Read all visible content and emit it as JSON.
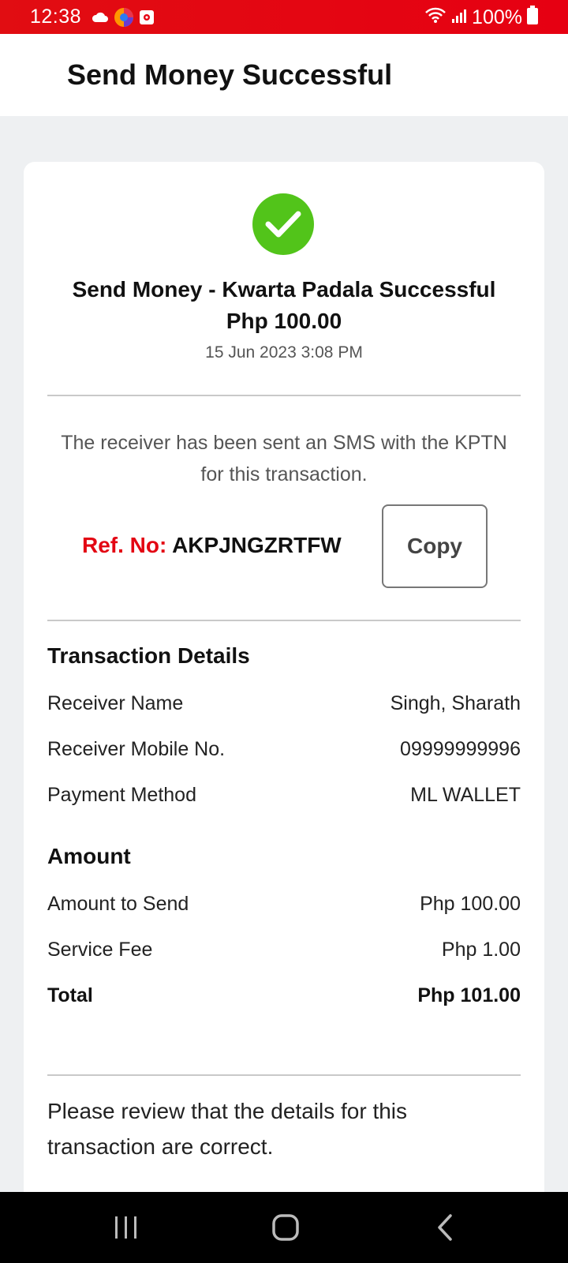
{
  "status_bar": {
    "time": "12:38",
    "battery": "100%",
    "icons": [
      "cloud-icon",
      "browser-icon",
      "camera-icon",
      "wifi-icon",
      "signal-icon",
      "battery-icon"
    ]
  },
  "header": {
    "title": "Send Money Successful"
  },
  "success": {
    "icon": "check-circle-icon",
    "title": "Send Money - Kwarta Padala Successful",
    "amount": "Php 100.00",
    "date": "15 Jun 2023 3:08 PM"
  },
  "sms_note": "The receiver has been sent an SMS with the KPTN for this transaction.",
  "reference": {
    "label": "Ref. No:",
    "value": "AKPJNGZRTFW",
    "copy_label": "Copy"
  },
  "transaction_details": {
    "title": "Transaction Details",
    "rows": [
      {
        "label": "Receiver Name",
        "value": "Singh, Sharath"
      },
      {
        "label": "Receiver Mobile No.",
        "value": "09999999996"
      },
      {
        "label": "Payment Method",
        "value": "ML WALLET"
      }
    ]
  },
  "amount": {
    "title": "Amount",
    "rows": [
      {
        "label": "Amount to Send",
        "value": "Php 100.00"
      },
      {
        "label": "Service Fee",
        "value": "Php 1.00"
      }
    ],
    "total": {
      "label": "Total",
      "value": "Php 101.00"
    }
  },
  "review_note": "Please review that the details for this transaction are correct.",
  "colors": {
    "status_bar": "#e60012",
    "accent_red": "#e30613",
    "success_green": "#52c41a"
  }
}
